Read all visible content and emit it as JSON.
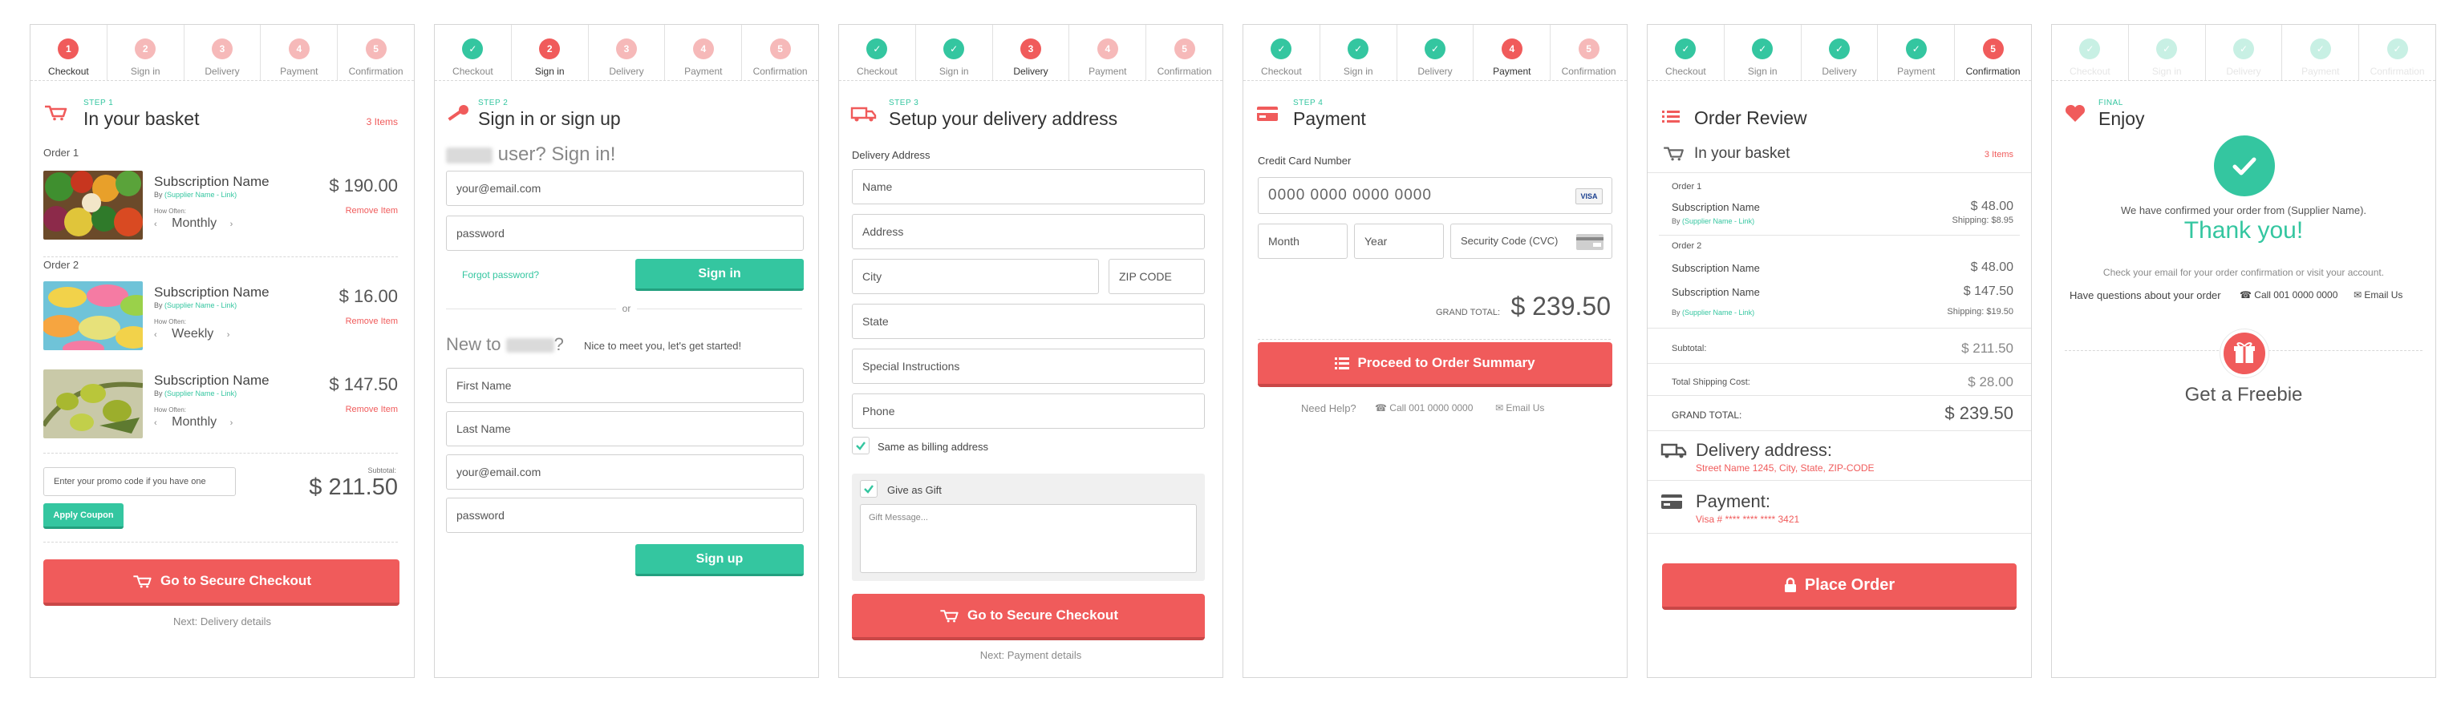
{
  "steps_labels": [
    "Checkout",
    "Sign in",
    "Delivery",
    "Payment",
    "Confirmation"
  ],
  "colors": {
    "accent": "#f05b5b",
    "brand_green": "#34c6a0"
  },
  "panel1": {
    "step_tag": "STEP 1",
    "title": "In your basket",
    "items_count": "3 Items",
    "order1_label": "Order 1",
    "order2_label": "Order 2",
    "items": [
      {
        "name": "Subscription Name",
        "by": "By",
        "supplier": "(Supplier Name - Link)",
        "price": "$ 190.00",
        "remove": "Remove Item",
        "how_often": "How Often:",
        "frequency": "Monthly",
        "img": "vegetables"
      },
      {
        "name": "Subscription Name",
        "by": "By",
        "supplier": "(Supplier Name - Link)",
        "price": "$ 16.00",
        "remove": "Remove Item",
        "how_often": "How Often:",
        "frequency": "Weekly",
        "img": "macarons"
      },
      {
        "name": "Subscription Name",
        "by": "By",
        "supplier": "(Supplier Name - Link)",
        "price": "$ 147.50",
        "remove": "Remove Item",
        "how_often": "How Often:",
        "frequency": "Monthly",
        "img": "olives"
      }
    ],
    "promo_placeholder": "Enter your promo code if you have one",
    "apply_coupon": "Apply Coupon",
    "subtotal_label": "Subtotal:",
    "subtotal": "$ 211.50",
    "checkout_button": "Go to Secure Checkout",
    "next_text": "Next: Delivery details"
  },
  "panel2": {
    "step_tag": "STEP 2",
    "title": "Sign in or sign up",
    "returning_text": "user? Sign in!",
    "email_placeholder": "your@email.com",
    "password_placeholder": "password",
    "forgot": "Forgot password?",
    "signin_button": "Sign in",
    "or": "or",
    "new_to": "New to",
    "new_to_suffix": "?",
    "nice_to_meet": "Nice to meet you, let's get started!",
    "first_name": "First Name",
    "last_name": "Last Name",
    "email2": "your@email.com",
    "password2": "password",
    "signup_button": "Sign up"
  },
  "panel3": {
    "step_tag": "STEP 3",
    "title": "Setup your delivery address",
    "section": "Delivery Address",
    "name": "Name",
    "address": "Address",
    "city": "City",
    "zip": "ZIP CODE",
    "state": "State",
    "special": "Special Instructions",
    "phone": "Phone",
    "same_billing": "Same as billing address",
    "give_gift": "Give as Gift",
    "gift_message": "Gift Message...",
    "checkout_button": "Go to Secure Checkout",
    "next_text": "Next: Payment details"
  },
  "panel4": {
    "step_tag": "STEP 4",
    "title": "Payment",
    "cc_label": "Credit Card Number",
    "cc_placeholder": "0000 0000 0000 0000",
    "card_brand": "VISA",
    "month": "Month",
    "year": "Year",
    "cvc": "Security Code (CVC)",
    "grand_total_label": "GRAND TOTAL:",
    "grand_total": "$ 239.50",
    "proceed_button": "Proceed to Order Summary",
    "need_help": "Need Help?",
    "call": "Call 001 0000 0000",
    "email_us": "Email Us"
  },
  "panel5": {
    "title": "Order Review",
    "basket_title": "In your basket",
    "items_count": "3 Items",
    "order1_label": "Order 1",
    "order2_label": "Order 2",
    "order1": [
      {
        "name": "Subscription Name",
        "price": "$ 48.00",
        "by": "By",
        "supplier": "(Supplier Name - Link)",
        "shipping": "Shipping: $8.95"
      }
    ],
    "order2": [
      {
        "name": "Subscription Name",
        "price": "$ 48.00"
      },
      {
        "name": "Subscription Name",
        "price": "$ 147.50",
        "by": "By",
        "supplier": "(Supplier Name - Link)",
        "shipping": "Shipping: $19.50"
      }
    ],
    "subtotal_label": "Subtotal:",
    "subtotal": "$ 211.50",
    "total_shipping_label": "Total Shipping Cost:",
    "total_shipping": "$ 28.00",
    "grand_total_label": "GRAND TOTAL:",
    "grand_total": "$ 239.50",
    "delivery_title": "Delivery address:",
    "delivery_value": "Street Name 1245, City, State, ZIP-CODE",
    "payment_title": "Payment:",
    "payment_value": "Visa # **** **** **** 3421",
    "place_order": "Place Order"
  },
  "panel6": {
    "step_tag": "FINAL",
    "title": "Enjoy",
    "confirmed": "We have confirmed your order from (Supplier Name).",
    "thank_you": "Thank you!",
    "check_email": "Check your email for your order confirmation or visit your account.",
    "questions": "Have questions about your order",
    "call": "Call 001 0000 0000",
    "email_us": "Email Us",
    "freebie": "Get a Freebie"
  }
}
